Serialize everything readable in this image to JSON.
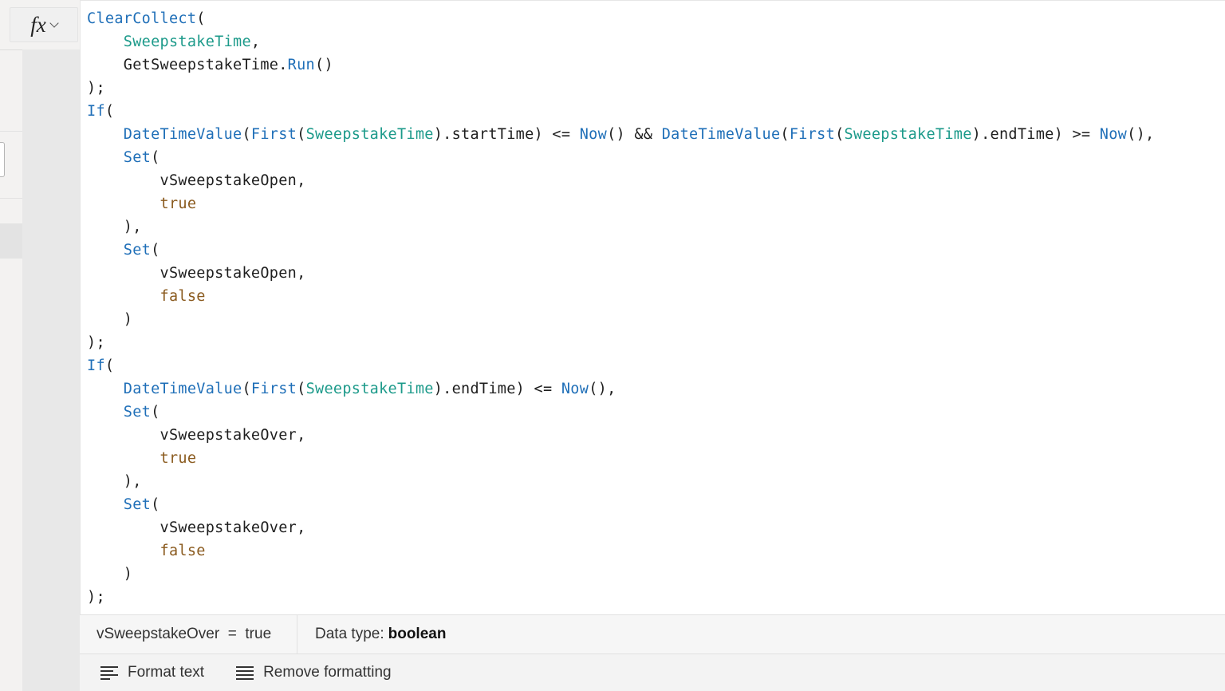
{
  "formula_bar": {
    "fx_label": "fx",
    "icons": [
      "fx-icon",
      "chevron-down-icon"
    ]
  },
  "code_lines": [
    [
      {
        "t": "fn",
        "v": "ClearCollect"
      },
      {
        "t": "pu",
        "v": "("
      }
    ],
    [
      {
        "t": "pu",
        "v": "    "
      },
      {
        "t": "tb",
        "v": "SweepstakeTime"
      },
      {
        "t": "pu",
        "v": ","
      }
    ],
    [
      {
        "t": "pu",
        "v": "    "
      },
      {
        "t": "id",
        "v": "GetSweepstakeTime"
      },
      {
        "t": "pu",
        "v": "."
      },
      {
        "t": "fn",
        "v": "Run"
      },
      {
        "t": "pu",
        "v": "()"
      }
    ],
    [
      {
        "t": "pu",
        "v": ");"
      }
    ],
    [
      {
        "t": "fn",
        "v": "If"
      },
      {
        "t": "pu",
        "v": "("
      }
    ],
    [
      {
        "t": "pu",
        "v": "    "
      },
      {
        "t": "fn",
        "v": "DateTimeValue"
      },
      {
        "t": "pu",
        "v": "("
      },
      {
        "t": "fn",
        "v": "First"
      },
      {
        "t": "pu",
        "v": "("
      },
      {
        "t": "tb",
        "v": "SweepstakeTime"
      },
      {
        "t": "pu",
        "v": ").startTime) <= "
      },
      {
        "t": "fn",
        "v": "Now"
      },
      {
        "t": "pu",
        "v": "() && "
      },
      {
        "t": "fn",
        "v": "DateTimeValue"
      },
      {
        "t": "pu",
        "v": "("
      },
      {
        "t": "fn",
        "v": "First"
      },
      {
        "t": "pu",
        "v": "("
      },
      {
        "t": "tb",
        "v": "SweepstakeTime"
      },
      {
        "t": "pu",
        "v": ").endTime) >= "
      },
      {
        "t": "fn",
        "v": "Now"
      },
      {
        "t": "pu",
        "v": "(),"
      }
    ],
    [
      {
        "t": "pu",
        "v": "    "
      },
      {
        "t": "fn",
        "v": "Set"
      },
      {
        "t": "pu",
        "v": "("
      }
    ],
    [
      {
        "t": "pu",
        "v": "        "
      },
      {
        "t": "id",
        "v": "vSweepstakeOpen"
      },
      {
        "t": "pu",
        "v": ","
      }
    ],
    [
      {
        "t": "pu",
        "v": "        "
      },
      {
        "t": "bo",
        "v": "true"
      }
    ],
    [
      {
        "t": "pu",
        "v": "    ),"
      }
    ],
    [
      {
        "t": "pu",
        "v": "    "
      },
      {
        "t": "fn",
        "v": "Set"
      },
      {
        "t": "pu",
        "v": "("
      }
    ],
    [
      {
        "t": "pu",
        "v": "        "
      },
      {
        "t": "id",
        "v": "vSweepstakeOpen"
      },
      {
        "t": "pu",
        "v": ","
      }
    ],
    [
      {
        "t": "pu",
        "v": "        "
      },
      {
        "t": "bo",
        "v": "false"
      }
    ],
    [
      {
        "t": "pu",
        "v": "    )"
      }
    ],
    [
      {
        "t": "pu",
        "v": ");"
      }
    ],
    [
      {
        "t": "fn",
        "v": "If"
      },
      {
        "t": "pu",
        "v": "("
      }
    ],
    [
      {
        "t": "pu",
        "v": "    "
      },
      {
        "t": "fn",
        "v": "DateTimeValue"
      },
      {
        "t": "pu",
        "v": "("
      },
      {
        "t": "fn",
        "v": "First"
      },
      {
        "t": "pu",
        "v": "("
      },
      {
        "t": "tb",
        "v": "SweepstakeTime"
      },
      {
        "t": "pu",
        "v": ").endTime) <= "
      },
      {
        "t": "fn",
        "v": "Now"
      },
      {
        "t": "pu",
        "v": "(),"
      }
    ],
    [
      {
        "t": "pu",
        "v": "    "
      },
      {
        "t": "fn",
        "v": "Set"
      },
      {
        "t": "pu",
        "v": "("
      }
    ],
    [
      {
        "t": "pu",
        "v": "        "
      },
      {
        "t": "id",
        "v": "vSweepstakeOver"
      },
      {
        "t": "pu",
        "v": ","
      }
    ],
    [
      {
        "t": "pu",
        "v": "        "
      },
      {
        "t": "bo",
        "v": "true"
      }
    ],
    [
      {
        "t": "pu",
        "v": "    ),"
      }
    ],
    [
      {
        "t": "pu",
        "v": "    "
      },
      {
        "t": "fn",
        "v": "Set"
      },
      {
        "t": "pu",
        "v": "("
      }
    ],
    [
      {
        "t": "pu",
        "v": "        "
      },
      {
        "t": "id",
        "v": "vSweepstakeOver"
      },
      {
        "t": "pu",
        "v": ","
      }
    ],
    [
      {
        "t": "pu",
        "v": "        "
      },
      {
        "t": "bo",
        "v": "false"
      }
    ],
    [
      {
        "t": "pu",
        "v": "    )"
      }
    ],
    [
      {
        "t": "pu",
        "v": ");"
      }
    ]
  ],
  "result": {
    "expression": "vSweepstakeOver  =  true",
    "data_type_label": "Data type:",
    "data_type_value": "boolean"
  },
  "toolbar": {
    "format_text_label": "Format text",
    "remove_formatting_label": "Remove formatting"
  },
  "colors": {
    "function": "#1f6fb8",
    "table": "#1c9a8a",
    "boolean": "#8a5a1e",
    "identifier": "#1e1e1e"
  }
}
